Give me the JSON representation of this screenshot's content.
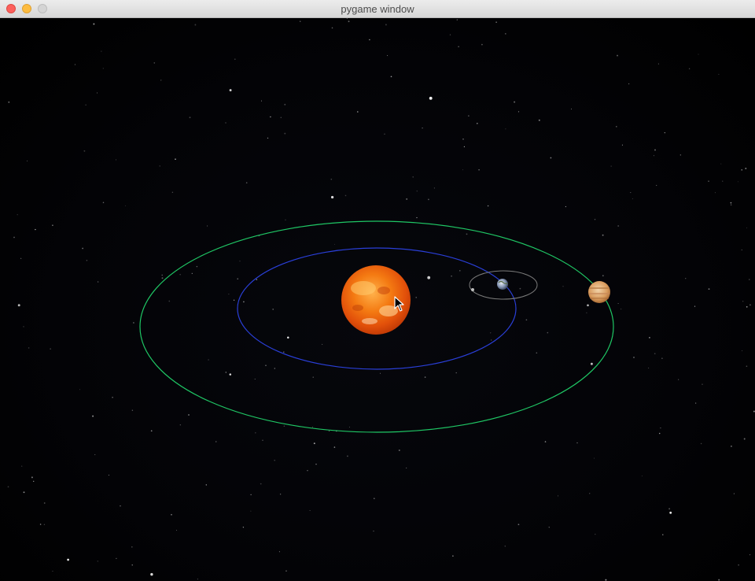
{
  "window": {
    "title": "pygame window"
  },
  "scene": {
    "background_color": "#030306",
    "sun": {
      "name": "sun",
      "color": "#f07010"
    },
    "orbits": [
      {
        "name": "inner-orbit",
        "color": "#2a3fd8"
      },
      {
        "name": "outer-orbit",
        "color": "#1fc765"
      },
      {
        "name": "moon-orbit",
        "color": "#7a7a7a"
      }
    ],
    "planets": [
      {
        "name": "earth",
        "color": "#7c8fb0"
      },
      {
        "name": "moon",
        "color": "#bfbfbf"
      },
      {
        "name": "jupiter",
        "color": "#d79a5c"
      }
    ],
    "cursor": "arrow-cursor"
  }
}
